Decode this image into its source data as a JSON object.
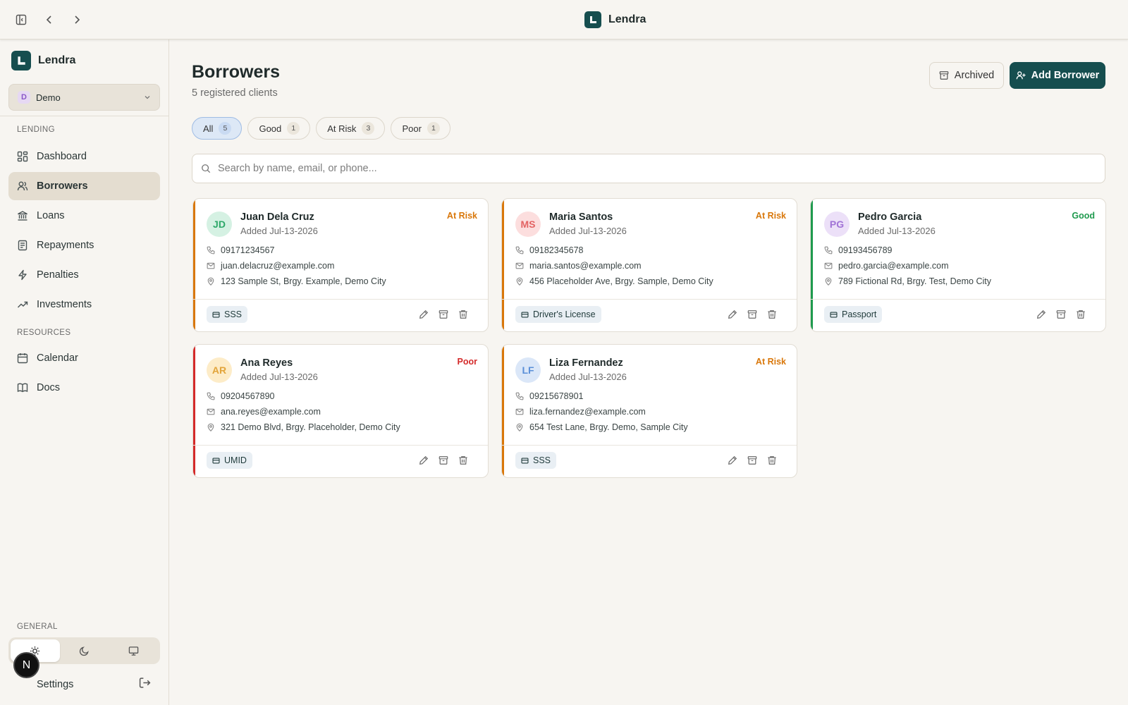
{
  "app": {
    "title": "Lendra"
  },
  "workspace": {
    "initial": "D",
    "name": "Demo"
  },
  "sidebar": {
    "sections": {
      "lending": "LENDING",
      "resources": "RESOURCES",
      "general": "GENERAL"
    },
    "items": [
      {
        "label": "Dashboard",
        "icon": "dashboard-icon"
      },
      {
        "label": "Borrowers",
        "icon": "users-icon",
        "active": true
      },
      {
        "label": "Loans",
        "icon": "bank-icon"
      },
      {
        "label": "Repayments",
        "icon": "receipt-icon"
      },
      {
        "label": "Penalties",
        "icon": "bolt-icon"
      },
      {
        "label": "Investments",
        "icon": "trending-up-icon"
      },
      {
        "label": "Calendar",
        "icon": "calendar-icon"
      },
      {
        "label": "Docs",
        "icon": "book-icon"
      }
    ],
    "settings_label": "Settings",
    "user_initial": "N",
    "theme_selected": "light"
  },
  "page": {
    "title": "Borrowers",
    "subtitle": "5 registered clients",
    "archived_label": "Archived",
    "add_label": "Add Borrower"
  },
  "filters": [
    {
      "label": "All",
      "count": "5",
      "active": true
    },
    {
      "label": "Good",
      "count": "1"
    },
    {
      "label": "At Risk",
      "count": "3"
    },
    {
      "label": "Poor",
      "count": "1"
    }
  ],
  "search": {
    "placeholder": "Search by name, email, or phone..."
  },
  "colors": {
    "brand": "#164e4f",
    "status_good": "#1f9a4e",
    "status_at_risk": "#d9770a",
    "status_poor": "#d42a2a"
  },
  "borrowers": [
    {
      "initials": "JD",
      "name": "Juan Dela Cruz",
      "added": "Added Jul-13-2026",
      "status": "At Risk",
      "phone": "09171234567",
      "email": "juan.delacruz@example.com",
      "address": "123 Sample St, Brgy. Example, Demo City",
      "doc": "SSS",
      "avatar_bg": "#d5f1e3",
      "avatar_fg": "#2ea86a"
    },
    {
      "initials": "MS",
      "name": "Maria Santos",
      "added": "Added Jul-13-2026",
      "status": "At Risk",
      "phone": "09182345678",
      "email": "maria.santos@example.com",
      "address": "456 Placeholder Ave, Brgy. Sample, Demo City",
      "doc": "Driver's License",
      "avatar_bg": "#fcdede",
      "avatar_fg": "#e36363"
    },
    {
      "initials": "PG",
      "name": "Pedro Garcia",
      "added": "Added Jul-13-2026",
      "status": "Good",
      "phone": "09193456789",
      "email": "pedro.garcia@example.com",
      "address": "789 Fictional Rd, Brgy. Test, Demo City",
      "doc": "Passport",
      "avatar_bg": "#ece0f8",
      "avatar_fg": "#a173d6"
    },
    {
      "initials": "AR",
      "name": "Ana Reyes",
      "added": "Added Jul-13-2026",
      "status": "Poor",
      "phone": "09204567890",
      "email": "ana.reyes@example.com",
      "address": "321 Demo Blvd, Brgy. Placeholder, Demo City",
      "doc": "UMID",
      "avatar_bg": "#fdecc8",
      "avatar_fg": "#e2a43a"
    },
    {
      "initials": "LF",
      "name": "Liza Fernandez",
      "added": "Added Jul-13-2026",
      "status": "At Risk",
      "phone": "09215678901",
      "email": "liza.fernandez@example.com",
      "address": "654 Test Lane, Brgy. Demo, Sample City",
      "doc": "SSS",
      "avatar_bg": "#dbe7f8",
      "avatar_fg": "#5a8fd8"
    }
  ]
}
